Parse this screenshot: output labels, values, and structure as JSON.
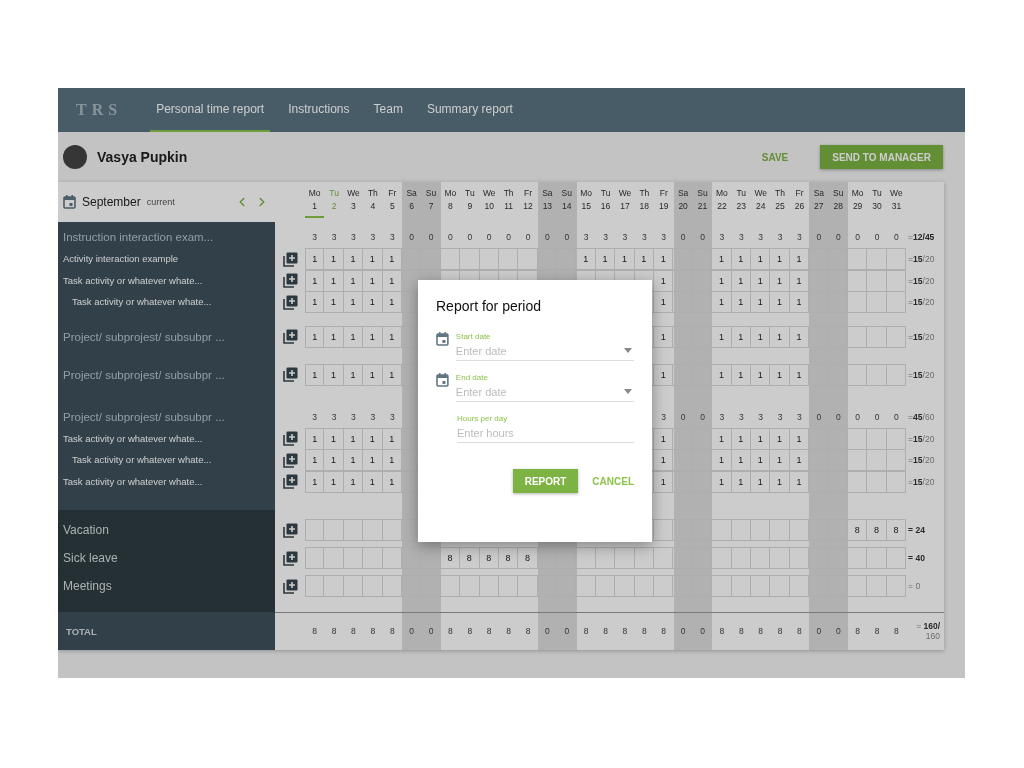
{
  "nav": {
    "logo": "TRS",
    "tabs": [
      {
        "label": "Personal time report",
        "selected": true
      },
      {
        "label": "Instructions",
        "selected": false
      },
      {
        "label": "Team",
        "selected": false
      },
      {
        "label": "Summary report",
        "selected": false
      }
    ]
  },
  "user": {
    "name": "Vasya Pupkin"
  },
  "actions": [
    {
      "kind": "text",
      "label": "SAVE"
    },
    {
      "kind": "contained",
      "label": "SEND TO MANAGER"
    }
  ],
  "calendar": {
    "month": "September",
    "note": "current"
  },
  "days": [
    {
      "weekday": "Mo",
      "day": "1",
      "weekend": false,
      "selected": true,
      "today": false
    },
    {
      "weekday": "Tu",
      "day": "2",
      "weekend": false,
      "selected": false,
      "today": true
    },
    {
      "weekday": "We",
      "day": "3",
      "weekend": false,
      "selected": false,
      "today": false
    },
    {
      "weekday": "Th",
      "day": "4",
      "weekend": false,
      "selected": false,
      "today": false
    },
    {
      "weekday": "Fr",
      "day": "5",
      "weekend": false,
      "selected": false,
      "today": false
    },
    {
      "weekday": "Sa",
      "day": "6",
      "weekend": true,
      "selected": false,
      "today": false
    },
    {
      "weekday": "Su",
      "day": "7",
      "weekend": true,
      "selected": false,
      "today": false
    },
    {
      "weekday": "Mo",
      "day": "8",
      "weekend": false,
      "selected": false,
      "today": false
    },
    {
      "weekday": "Tu",
      "day": "9",
      "weekend": false,
      "selected": false,
      "today": false
    },
    {
      "weekday": "We",
      "day": "10",
      "weekend": false,
      "selected": false,
      "today": false
    },
    {
      "weekday": "Th",
      "day": "11",
      "weekend": false,
      "selected": false,
      "today": false
    },
    {
      "weekday": "Fr",
      "day": "12",
      "weekend": false,
      "selected": false,
      "today": false
    },
    {
      "weekday": "Sa",
      "day": "13",
      "weekend": true,
      "selected": false,
      "today": false
    },
    {
      "weekday": "Su",
      "day": "14",
      "weekend": true,
      "selected": false,
      "today": false
    },
    {
      "weekday": "Mo",
      "day": "15",
      "weekend": false,
      "selected": false,
      "today": false
    },
    {
      "weekday": "Tu",
      "day": "16",
      "weekend": false,
      "selected": false,
      "today": false
    },
    {
      "weekday": "We",
      "day": "17",
      "weekend": false,
      "selected": false,
      "today": false
    },
    {
      "weekday": "Th",
      "day": "18",
      "weekend": false,
      "selected": false,
      "today": false
    },
    {
      "weekday": "Fr",
      "day": "19",
      "weekend": false,
      "selected": false,
      "today": false
    },
    {
      "weekday": "Sa",
      "day": "20",
      "weekend": true,
      "selected": false,
      "today": false
    },
    {
      "weekday": "Su",
      "day": "21",
      "weekend": true,
      "selected": false,
      "today": false
    },
    {
      "weekday": "Mo",
      "day": "22",
      "weekend": false,
      "selected": false,
      "today": false
    },
    {
      "weekday": "Tu",
      "day": "23",
      "weekend": false,
      "selected": false,
      "today": false
    },
    {
      "weekday": "We",
      "day": "24",
      "weekend": false,
      "selected": false,
      "today": false
    },
    {
      "weekday": "Th",
      "day": "25",
      "weekend": false,
      "selected": false,
      "today": false
    },
    {
      "weekday": "Fr",
      "day": "26",
      "weekend": false,
      "selected": false,
      "today": false
    },
    {
      "weekday": "Sa",
      "day": "27",
      "weekend": true,
      "selected": false,
      "today": false
    },
    {
      "weekday": "Su",
      "day": "28",
      "weekend": true,
      "selected": false,
      "today": false
    },
    {
      "weekday": "Mo",
      "day": "29",
      "weekend": false,
      "selected": false,
      "today": false
    },
    {
      "weekday": "Tu",
      "day": "30",
      "weekend": false,
      "selected": false,
      "today": false
    },
    {
      "weekday": "We",
      "day": "31",
      "weekend": false,
      "selected": false,
      "today": false
    }
  ],
  "sections": [
    {
      "kind": "projects",
      "rows": [
        {
          "kind": "group",
          "label": "Instruction interaction exam...",
          "total": "=**12/45**",
          "cells": [
            "3",
            "3",
            "3",
            "3",
            "3",
            "0",
            "0",
            "0",
            "0",
            "0",
            "0",
            "0",
            "0",
            "0",
            "3",
            "3",
            "3",
            "3",
            "3",
            "0",
            "0",
            "3",
            "3",
            "3",
            "3",
            "3",
            "0",
            "0",
            "0",
            "0",
            "0"
          ],
          "children": [
            {
              "kind": "task",
              "label": "Activity interaction example",
              "total": "=**15**/20",
              "cells": [
                "1",
                "1",
                "1",
                "1",
                "1",
                null,
                null,
                null,
                null,
                null,
                null,
                null,
                null,
                null,
                "1",
                "1",
                "1",
                "1",
                "1",
                null,
                null,
                "1",
                "1",
                "1",
                "1",
                "1",
                null,
                null,
                null,
                null,
                null
              ]
            },
            {
              "kind": "task",
              "label": "Task activity or whatever whate...",
              "total": "=**15**/20",
              "cells": [
                "1",
                "1",
                "1",
                "1",
                "1",
                null,
                null,
                null,
                null,
                null,
                null,
                null,
                null,
                null,
                null,
                null,
                null,
                null,
                "1",
                null,
                null,
                "1",
                "1",
                "1",
                "1",
                "1",
                null,
                null,
                null,
                null,
                null
              ],
              "children": [
                {
                  "kind": "task",
                  "label": "Task activity or whatever whate...",
                  "total": "=**15**/20",
                  "cells": [
                    "1",
                    "1",
                    "1",
                    "1",
                    "1",
                    null,
                    null,
                    null,
                    null,
                    null,
                    null,
                    null,
                    null,
                    null,
                    null,
                    null,
                    null,
                    null,
                    "1",
                    null,
                    null,
                    "1",
                    "1",
                    "1",
                    "1",
                    "1",
                    null,
                    null,
                    null,
                    null,
                    null
                  ]
                }
              ]
            }
          ]
        },
        {
          "kind": "project",
          "label": "Project/ subprojest/ subsubpr ...",
          "total": "=**15**/20",
          "cells": [
            "1",
            "1",
            "1",
            "1",
            "1",
            null,
            null,
            null,
            null,
            null,
            null,
            null,
            null,
            null,
            null,
            null,
            null,
            null,
            "1",
            null,
            null,
            "1",
            "1",
            "1",
            "1",
            "1",
            null,
            null,
            null,
            null,
            null
          ]
        },
        {
          "kind": "project",
          "label": "Project/ subprojest/ subsubpr ...",
          "total": "=**15**/20",
          "cells": [
            "1",
            "1",
            "1",
            "1",
            "1",
            null,
            null,
            null,
            null,
            null,
            null,
            null,
            null,
            null,
            null,
            null,
            null,
            null,
            "1",
            null,
            null,
            "1",
            "1",
            "1",
            "1",
            "1",
            null,
            null,
            null,
            null,
            null
          ]
        },
        {
          "kind": "group",
          "label": "Project/ subprojest/ subsubpr ...",
          "total": "=**45**/60",
          "cells": [
            "3",
            "3",
            "3",
            "3",
            "3",
            null,
            null,
            null,
            null,
            null,
            null,
            null,
            null,
            null,
            null,
            null,
            null,
            null,
            "3",
            "0",
            "0",
            "3",
            "3",
            "3",
            "3",
            "3",
            "0",
            "0",
            "0",
            "0",
            "0"
          ],
          "children": [
            {
              "kind": "task",
              "label": "Task activity or whatever whate...",
              "total": "=**15**/20",
              "cells": [
                "1",
                "1",
                "1",
                "1",
                "1",
                null,
                null,
                null,
                null,
                null,
                null,
                null,
                null,
                null,
                null,
                null,
                null,
                null,
                "1",
                null,
                null,
                "1",
                "1",
                "1",
                "1",
                "1",
                null,
                null,
                null,
                null,
                null
              ],
              "children": [
                {
                  "kind": "task",
                  "label": "Task activity or whatever whate...",
                  "total": "=**15**/20",
                  "cells": [
                    "1",
                    "1",
                    "1",
                    "1",
                    "1",
                    null,
                    null,
                    null,
                    null,
                    null,
                    null,
                    null,
                    null,
                    null,
                    null,
                    null,
                    null,
                    null,
                    "1",
                    null,
                    null,
                    "1",
                    "1",
                    "1",
                    "1",
                    "1",
                    null,
                    null,
                    null,
                    null,
                    null
                  ]
                }
              ]
            },
            {
              "kind": "task",
              "label": "Task activity or whatever whate...",
              "total": "=**15**/20",
              "cells": [
                "1",
                "1",
                "1",
                "1",
                "1",
                null,
                null,
                null,
                null,
                null,
                null,
                null,
                null,
                null,
                null,
                null,
                null,
                null,
                "1",
                null,
                null,
                "1",
                "1",
                "1",
                "1",
                "1",
                null,
                null,
                null,
                null,
                null
              ]
            }
          ]
        }
      ]
    },
    {
      "kind": "absence",
      "rows": [
        {
          "kind": "absence",
          "label": "Vacation",
          "total": "**= 24**",
          "cells": [
            null,
            null,
            null,
            null,
            null,
            null,
            null,
            null,
            null,
            null,
            null,
            null,
            null,
            null,
            null,
            null,
            null,
            null,
            null,
            null,
            null,
            null,
            null,
            null,
            null,
            null,
            null,
            null,
            "8",
            "8",
            "8"
          ]
        },
        {
          "kind": "absence",
          "label": "Sick leave",
          "total": "**= 40**",
          "cells": [
            null,
            null,
            null,
            null,
            null,
            null,
            null,
            "8",
            "8",
            "8",
            "8",
            "8",
            null,
            null,
            null,
            null,
            null,
            null,
            null,
            null,
            null,
            null,
            null,
            null,
            null,
            null,
            null,
            null,
            null,
            null,
            null
          ]
        },
        {
          "kind": "absence",
          "label": "Meetings",
          "total": "= 0"
        }
      ]
    }
  ],
  "total": {
    "label": "TOTAL",
    "total": "= **160/** 160",
    "cells": [
      "8",
      "8",
      "8",
      "8",
      "8",
      "0",
      "0",
      "8",
      "8",
      "8",
      "8",
      "8",
      "0",
      "0",
      "8",
      "8",
      "8",
      "8",
      "8",
      "0",
      "0",
      "8",
      "8",
      "8",
      "8",
      "8",
      "0",
      "0",
      "8",
      "8",
      "8"
    ]
  },
  "dialog": {
    "title": "Report for period",
    "fields": [
      {
        "kind": "date",
        "label": "Start date",
        "placeholder": "Enter date"
      },
      {
        "kind": "date",
        "label": "End date",
        "placeholder": "Enter date"
      },
      {
        "kind": "number",
        "label": "Hours per day",
        "placeholder": "Enter hours"
      }
    ],
    "buttons": [
      {
        "kind": "contained",
        "label": "REPORT"
      },
      {
        "kind": "text",
        "label": "CANCEL"
      }
    ]
  }
}
